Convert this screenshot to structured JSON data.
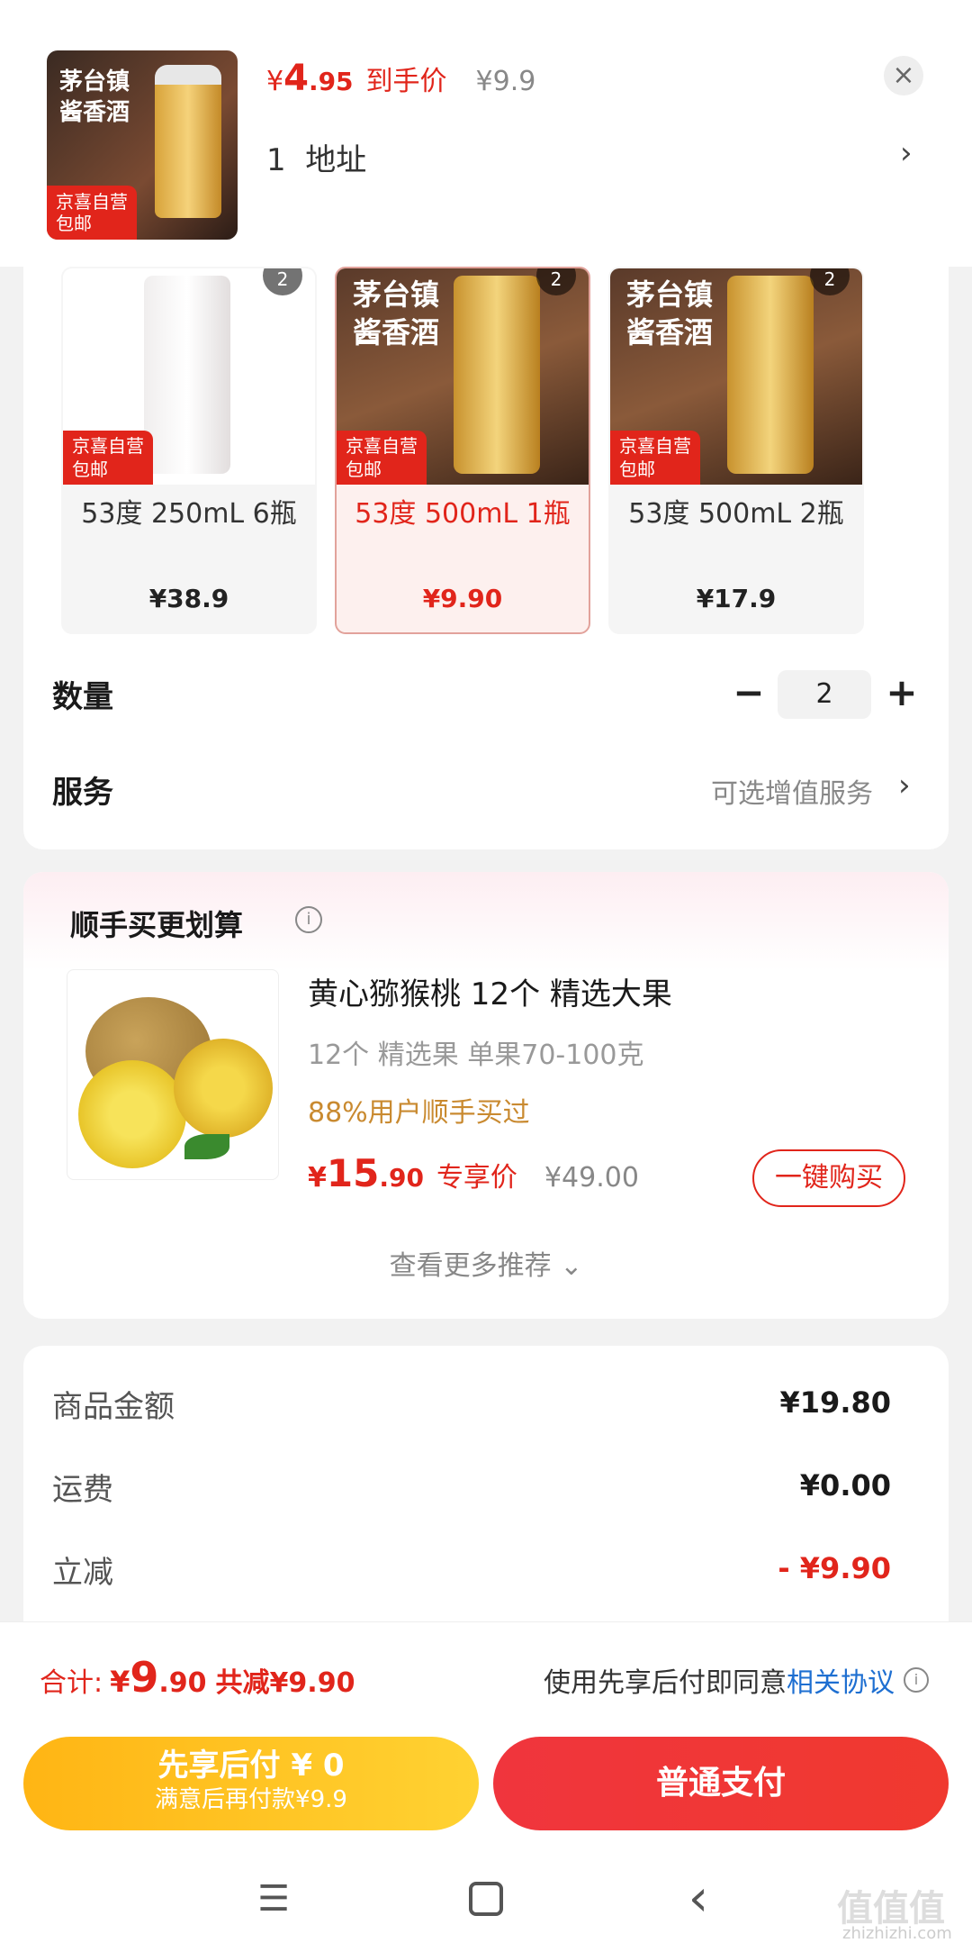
{
  "header": {
    "thumb_brand": "茅台镇\n酱香酒",
    "thumb_tag": "京喜自营\n包邮",
    "price_symbol": "¥",
    "price_integer": "4",
    "price_decimal": ".95",
    "price_label": "到手价",
    "original_price": "¥9.9",
    "close_icon": "×",
    "address": "1  地址",
    "address_chevron": "›"
  },
  "variants": [
    {
      "title": "",
      "badge": "京喜自营\n包邮",
      "number": "2",
      "name": "53度 250mL 6瓶",
      "price": "¥38.9",
      "selected": false
    },
    {
      "title": "茅台镇\n酱香酒",
      "badge": "京喜自营\n包邮",
      "number": "2",
      "name": "53度 500mL 1瓶",
      "price": "¥9.90",
      "selected": true
    },
    {
      "title": "茅台镇\n酱香酒",
      "badge": "京喜自营\n包邮",
      "number": "2",
      "name": "53度 500mL 2瓶",
      "price": "¥17.9",
      "selected": false
    }
  ],
  "quantity": {
    "label": "数量",
    "minus": "−",
    "value": "2",
    "plus": "+"
  },
  "service": {
    "label": "服务",
    "value": "可选增值服务",
    "chevron": "›"
  },
  "recommend": {
    "title": "顺手买更划算",
    "info_icon": "i",
    "name": "黄心猕猴桃 12个 精选大果",
    "spec": "12个 精选果 单果70-100克",
    "buyers": "88%用户顺手买过",
    "price_symbol": "¥",
    "price_integer": "15",
    "price_decimal": ".90",
    "price_label": "专享价",
    "original_price": "¥49.00",
    "buy_button": "一键购买",
    "more": "查看更多推荐 ⌄"
  },
  "summary": {
    "rows": [
      {
        "label": "商品金额",
        "value": "¥19.80"
      },
      {
        "label": "运费",
        "value": "¥0.00"
      },
      {
        "label": "立减",
        "value": "- ¥9.90"
      }
    ]
  },
  "total": {
    "label": "合计:",
    "symbol": "¥",
    "integer": "9",
    "decimal": ".90",
    "saved": "共减¥9.90",
    "agreement_text": "使用先享后付即同意",
    "agreement_link": "相关协议",
    "info_icon": "i"
  },
  "buttons": {
    "later_line1": "先享后付 ¥ 0",
    "later_line2": "满意后再付款¥9.9",
    "pay": "普通支付"
  },
  "nav": {
    "menu_icon": "☰",
    "back_icon": "‹"
  },
  "watermark": {
    "main": "值值值",
    "sub": "zhizhizhi.com"
  },
  "colors": {
    "accent": "#e1251b",
    "later_button": "#ffc020",
    "link": "#1e6fd1"
  }
}
